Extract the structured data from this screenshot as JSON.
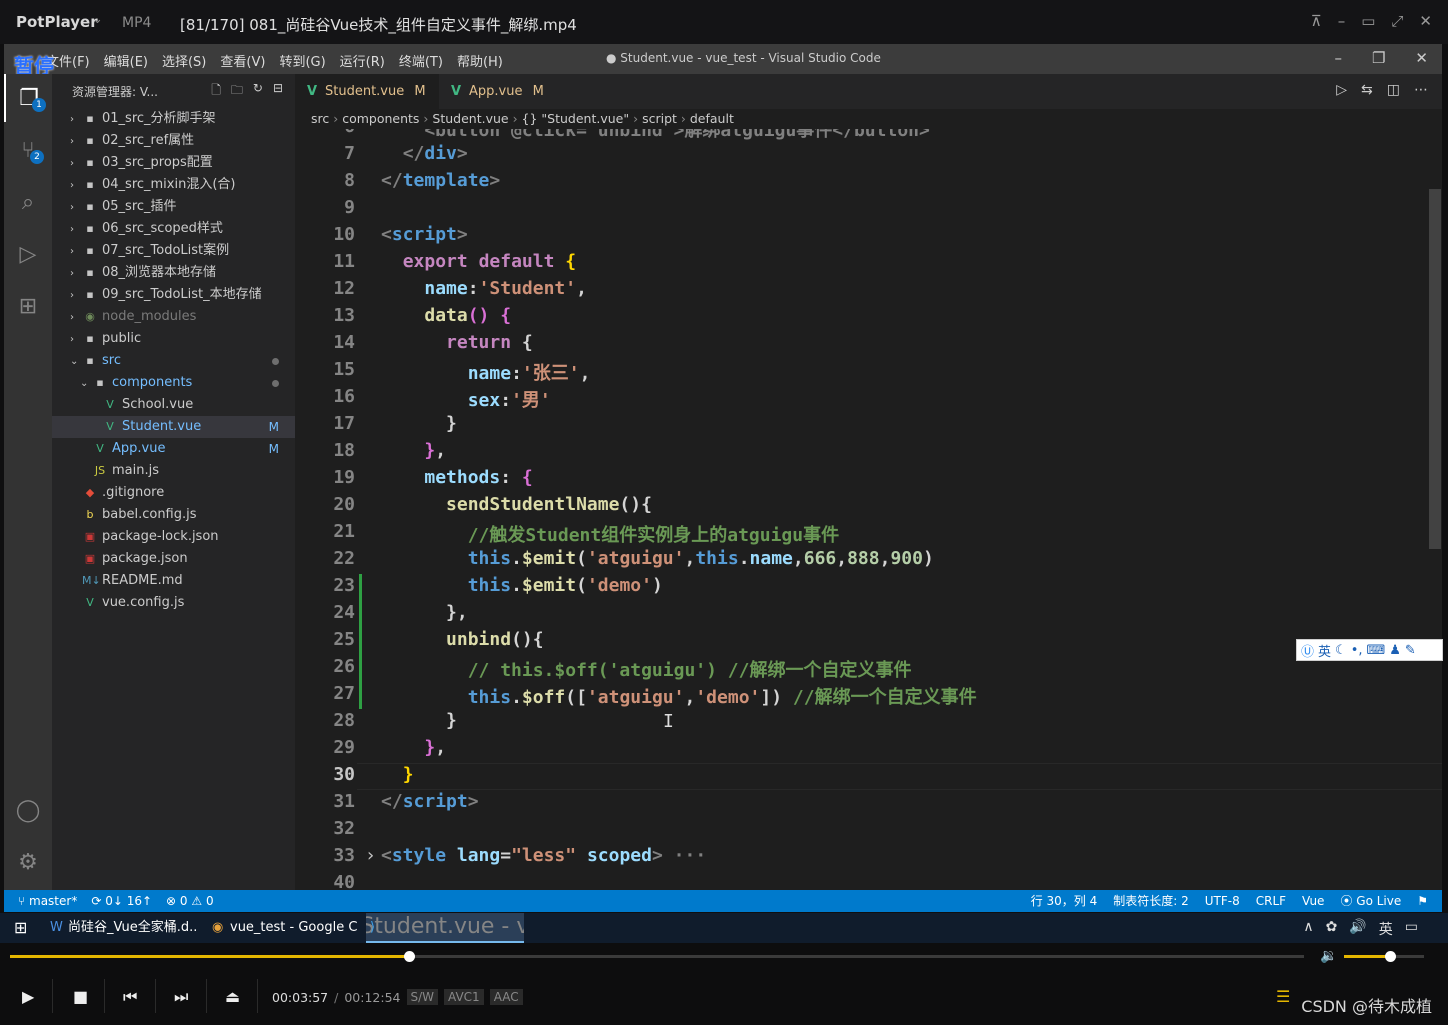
{
  "player": {
    "brand": "PotPlayer",
    "format": "MP4",
    "file": "[81/170] 081_尚硅谷Vue技术_组件自定义事件_解绑.mp4",
    "pause_badge": "暂停",
    "time_current": "00:03:57",
    "time_total": "00:12:54",
    "tag_sw": "S/W",
    "tag_video": "AVC1",
    "tag_audio": "AAC",
    "progress_fraction": 0.308,
    "volume_fraction": 0.58,
    "watermark": "CSDN @待木成植"
  },
  "vscode": {
    "window_title": "● Student.vue - vue_test - Visual Studio Code",
    "menu": [
      "文件(F)",
      "编辑(E)",
      "选择(S)",
      "查看(V)",
      "转到(G)",
      "运行(R)",
      "终端(T)",
      "帮助(H)"
    ],
    "explorer_title": "资源管理器: V...",
    "badges": {
      "explorer": "1",
      "scm": "2"
    },
    "tree": [
      {
        "label": "01_src_分析脚手架",
        "type": "folder",
        "depth": 0,
        "open": false
      },
      {
        "label": "02_src_ref属性",
        "type": "folder",
        "depth": 0,
        "open": false
      },
      {
        "label": "03_src_props配置",
        "type": "folder",
        "depth": 0,
        "open": false
      },
      {
        "label": "04_src_mixin混入(合)",
        "type": "folder",
        "depth": 0,
        "open": false
      },
      {
        "label": "05_src_插件",
        "type": "folder",
        "depth": 0,
        "open": false
      },
      {
        "label": "06_src_scoped样式",
        "type": "folder",
        "depth": 0,
        "open": false
      },
      {
        "label": "07_src_TodoList案例",
        "type": "folder",
        "depth": 0,
        "open": false
      },
      {
        "label": "08_浏览器本地存储",
        "type": "folder",
        "depth": 0,
        "open": false
      },
      {
        "label": "09_src_TodoList_本地存储",
        "type": "folder",
        "depth": 0,
        "open": false
      },
      {
        "label": "node_modules",
        "type": "node",
        "depth": 0,
        "open": false
      },
      {
        "label": "public",
        "type": "folder",
        "depth": 0,
        "open": false
      },
      {
        "label": "src",
        "type": "folder",
        "depth": 0,
        "open": true,
        "marker": "dot"
      },
      {
        "label": "components",
        "type": "folder",
        "depth": 1,
        "open": true,
        "marker": "dot"
      },
      {
        "label": "School.vue",
        "type": "vue",
        "depth": 2
      },
      {
        "label": "Student.vue",
        "type": "vue",
        "depth": 2,
        "marker": "M",
        "selected": true
      },
      {
        "label": "App.vue",
        "type": "vue",
        "depth": 1,
        "marker": "M"
      },
      {
        "label": "main.js",
        "type": "js",
        "depth": 1
      },
      {
        "label": ".gitignore",
        "type": "git",
        "depth": 0
      },
      {
        "label": "babel.config.js",
        "type": "babel",
        "depth": 0
      },
      {
        "label": "package-lock.json",
        "type": "json",
        "depth": 0
      },
      {
        "label": "package.json",
        "type": "json",
        "depth": 0
      },
      {
        "label": "README.md",
        "type": "md",
        "depth": 0
      },
      {
        "label": "vue.config.js",
        "type": "vue",
        "depth": 0
      }
    ],
    "tabs": [
      {
        "label": "Student.vue",
        "marker": "M",
        "dirty": true,
        "active": true
      },
      {
        "label": "App.vue",
        "marker": "M",
        "dirty": false,
        "active": false
      }
    ],
    "breadcrumb": [
      "src",
      "components",
      "Student.vue",
      "{} \"Student.vue\"",
      "script",
      "default"
    ],
    "code_lines": [
      {
        "n": "6",
        "segs": [
          [
            "    <button @click=\"unbind\">解绑atguigu事件</button>",
            "t-tag"
          ]
        ]
      },
      {
        "n": "7",
        "segs": [
          [
            "  ",
            "t"
          ],
          [
            "</",
            "t-tag"
          ],
          [
            "div",
            "t-name"
          ],
          [
            ">",
            "t-tag"
          ]
        ]
      },
      {
        "n": "8",
        "segs": [
          [
            "</",
            "t-tag"
          ],
          [
            "template",
            "t-name"
          ],
          [
            ">",
            "t-tag"
          ]
        ]
      },
      {
        "n": "9",
        "segs": []
      },
      {
        "n": "10",
        "segs": [
          [
            "<",
            "t-tag"
          ],
          [
            "script",
            "t-name"
          ],
          [
            ">",
            "t-tag"
          ]
        ]
      },
      {
        "n": "11",
        "segs": [
          [
            "  ",
            "t"
          ],
          [
            "export",
            "t-kw"
          ],
          [
            " ",
            "t"
          ],
          [
            "default",
            "t-kw"
          ],
          [
            " ",
            "t"
          ],
          [
            "{",
            "t-brk"
          ]
        ]
      },
      {
        "n": "12",
        "segs": [
          [
            "    ",
            "t"
          ],
          [
            "name",
            "t-prop"
          ],
          [
            ":",
            "t"
          ],
          [
            "'Student'",
            "t-str"
          ],
          [
            ",",
            "t"
          ]
        ]
      },
      {
        "n": "13",
        "segs": [
          [
            "    ",
            "t"
          ],
          [
            "data",
            "t-fn"
          ],
          [
            "()",
            "t-brk2"
          ],
          [
            " ",
            "t"
          ],
          [
            "{",
            "t-brk2"
          ]
        ]
      },
      {
        "n": "14",
        "segs": [
          [
            "      ",
            "t"
          ],
          [
            "return",
            "t-kw"
          ],
          [
            " {",
            "t"
          ]
        ]
      },
      {
        "n": "15",
        "segs": [
          [
            "        ",
            "t"
          ],
          [
            "name",
            "t-prop"
          ],
          [
            ":",
            "t"
          ],
          [
            "'张三'",
            "t-str"
          ],
          [
            ",",
            "t"
          ]
        ]
      },
      {
        "n": "16",
        "segs": [
          [
            "        ",
            "t"
          ],
          [
            "sex",
            "t-prop"
          ],
          [
            ":",
            "t"
          ],
          [
            "'男'",
            "t-str"
          ]
        ]
      },
      {
        "n": "17",
        "segs": [
          [
            "      }",
            "t"
          ]
        ]
      },
      {
        "n": "18",
        "segs": [
          [
            "    ",
            "t"
          ],
          [
            "}",
            "t-brk2"
          ],
          [
            ",",
            "t"
          ]
        ]
      },
      {
        "n": "19",
        "segs": [
          [
            "    ",
            "t"
          ],
          [
            "methods",
            "t-prop"
          ],
          [
            ": ",
            "t"
          ],
          [
            "{",
            "t-brk2"
          ]
        ]
      },
      {
        "n": "20",
        "segs": [
          [
            "      ",
            "t"
          ],
          [
            "sendStudentlName",
            "t-fn"
          ],
          [
            "(){",
            "t"
          ]
        ]
      },
      {
        "n": "21",
        "segs": [
          [
            "        ",
            "t"
          ],
          [
            "//触发Student组件实例身上的atguigu事件",
            "t-cm"
          ]
        ]
      },
      {
        "n": "22",
        "segs": [
          [
            "        ",
            "t"
          ],
          [
            "this",
            "t-this"
          ],
          [
            ".",
            "t"
          ],
          [
            "$emit",
            "t-fn"
          ],
          [
            "(",
            "t"
          ],
          [
            "'atguigu'",
            "t-str"
          ],
          [
            ",",
            "t"
          ],
          [
            "this",
            "t-this"
          ],
          [
            ".",
            "t"
          ],
          [
            "name",
            "t-prop"
          ],
          [
            ",",
            "t"
          ],
          [
            "666",
            "t-num"
          ],
          [
            ",",
            "t"
          ],
          [
            "888",
            "t-num"
          ],
          [
            ",",
            "t"
          ],
          [
            "900",
            "t-num"
          ],
          [
            ")",
            "t"
          ]
        ]
      },
      {
        "n": "23",
        "segs": [
          [
            "        ",
            "t"
          ],
          [
            "this",
            "t-this"
          ],
          [
            ".",
            "t"
          ],
          [
            "$emit",
            "t-fn"
          ],
          [
            "(",
            "t"
          ],
          [
            "'demo'",
            "t-str"
          ],
          [
            ")",
            "t"
          ]
        ]
      },
      {
        "n": "24",
        "segs": [
          [
            "      },",
            "t"
          ]
        ]
      },
      {
        "n": "25",
        "segs": [
          [
            "      ",
            "t"
          ],
          [
            "unbind",
            "t-fn"
          ],
          [
            "(){",
            "t"
          ]
        ]
      },
      {
        "n": "26",
        "segs": [
          [
            "        ",
            "t"
          ],
          [
            "// this.$off('atguigu') //解绑一个自定义事件",
            "t-cm"
          ]
        ]
      },
      {
        "n": "27",
        "segs": [
          [
            "        ",
            "t"
          ],
          [
            "this",
            "t-this"
          ],
          [
            ".",
            "t"
          ],
          [
            "$off",
            "t-fn"
          ],
          [
            "([",
            "t"
          ],
          [
            "'atguigu'",
            "t-str"
          ],
          [
            ",",
            "t"
          ],
          [
            "'demo'",
            "t-str"
          ],
          [
            "])",
            "t"
          ],
          [
            " //解绑一个自定义事件",
            "t-cm"
          ]
        ]
      },
      {
        "n": "28",
        "segs": [
          [
            "      }",
            "t"
          ]
        ]
      },
      {
        "n": "29",
        "segs": [
          [
            "    ",
            "t"
          ],
          [
            "}",
            "t-brk2"
          ],
          [
            ",",
            "t"
          ]
        ]
      },
      {
        "n": "30",
        "segs": [
          [
            "  ",
            "t"
          ],
          [
            "}",
            "t-brk"
          ]
        ]
      },
      {
        "n": "31",
        "segs": [
          [
            "</",
            "t-tag"
          ],
          [
            "script",
            "t-name"
          ],
          [
            ">",
            "t-tag"
          ]
        ]
      },
      {
        "n": "32",
        "segs": []
      },
      {
        "n": "33",
        "segs": [
          [
            "<",
            "t-tag"
          ],
          [
            "style",
            "t-name"
          ],
          [
            " ",
            "t"
          ],
          [
            "lang",
            "t-attr"
          ],
          [
            "=",
            "t"
          ],
          [
            "\"less\"",
            "t-str"
          ],
          [
            " ",
            "t"
          ],
          [
            "scoped",
            "t-attr"
          ],
          [
            ">",
            "t-tag"
          ],
          [
            " ···",
            "t-tag"
          ]
        ]
      },
      {
        "n": "40",
        "segs": []
      }
    ],
    "ime": "英",
    "status": {
      "branch": "master*",
      "sync": "0↓ 16↑",
      "problems": "0",
      "warnings": "0",
      "position": "行 30，列 4",
      "tab_size": "制表符长度: 2",
      "encoding": "UTF-8",
      "eol": "CRLF",
      "language": "Vue",
      "golive": "Go Live"
    }
  },
  "taskbar": {
    "items": [
      "尚硅谷_Vue全家桶.d...",
      "vue_test - Google C...",
      "● Student.vue - vue..."
    ],
    "ime": "英"
  }
}
